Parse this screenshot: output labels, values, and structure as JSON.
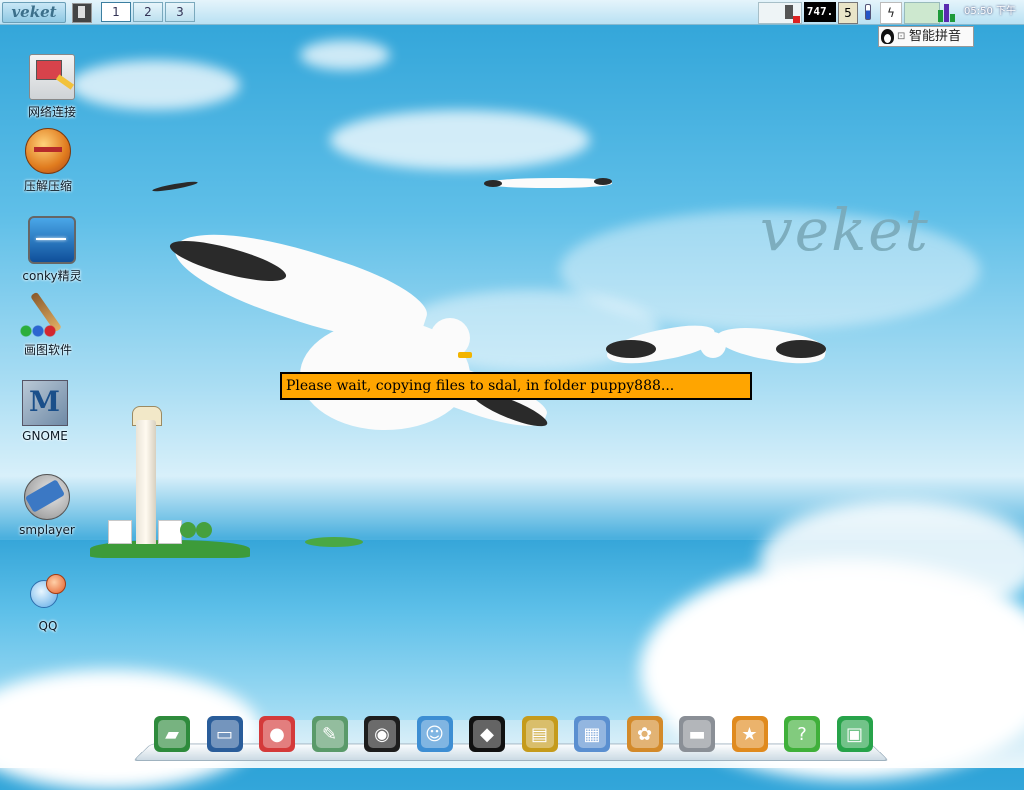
{
  "top_panel": {
    "menu_label": "veket",
    "workspaces": [
      "1",
      "2",
      "3"
    ],
    "active_workspace": "1",
    "tray": {
      "cpu_readout": "747.",
      "clipboard_label": "5",
      "clock": "05:50",
      "ampm": "下午"
    }
  },
  "ime": {
    "label": "智能拼音"
  },
  "desktop_icons": [
    {
      "label": "网络连接",
      "icon": "network-icon"
    },
    {
      "label": "压解压缩",
      "icon": "archive-icon"
    },
    {
      "label": "conky精灵",
      "icon": "conky-icon"
    },
    {
      "label": "画图软件",
      "icon": "paint-icon"
    },
    {
      "label": "GNOME",
      "icon": "gnome-icon"
    },
    {
      "label": "smplayer",
      "icon": "smplayer-icon"
    },
    {
      "label": "QQ",
      "icon": "qq-icon"
    }
  ],
  "wallpaper": {
    "logo_text": "veket"
  },
  "message": {
    "text": "Please wait, copying files to sdal, in folder puppy888..."
  },
  "dock": {
    "items": [
      {
        "icon": "file-manager-icon",
        "color": "#2e8b3c"
      },
      {
        "icon": "monitor-icon",
        "color": "#2a5d9a"
      },
      {
        "icon": "hedgehog-icon",
        "color": "#d43a3a"
      },
      {
        "icon": "editor-icon",
        "color": "#5a9a6a"
      },
      {
        "icon": "media-player-icon",
        "color": "#1d1d1d"
      },
      {
        "icon": "user-icon",
        "color": "#3d8ed3"
      },
      {
        "icon": "penguin-icon",
        "color": "#111111"
      },
      {
        "icon": "notebook-icon",
        "color": "#c59b1c"
      },
      {
        "icon": "chart-icon",
        "color": "#5a8fd0"
      },
      {
        "icon": "palette-icon",
        "color": "#d38a2a"
      },
      {
        "icon": "usb-drive-icon",
        "color": "#8a8f96"
      },
      {
        "icon": "game-icon",
        "color": "#e08a1e"
      },
      {
        "icon": "help-icon",
        "color": "#3fb03a"
      },
      {
        "icon": "camera-icon",
        "color": "#27a34a"
      }
    ]
  }
}
